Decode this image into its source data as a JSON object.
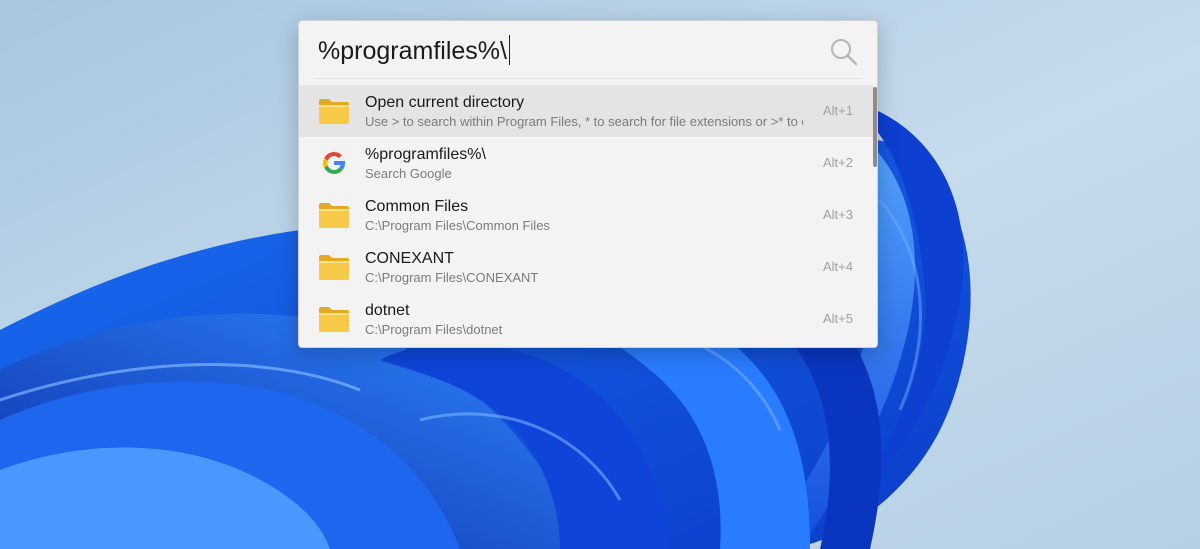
{
  "search": {
    "query": "%programfiles%\\"
  },
  "results": [
    {
      "icon": "folder-icon",
      "title": "Open current directory",
      "subtitle": "Use > to search within Program Files, * to search for file extensions or >* to combine both",
      "shortcut": "Alt+1"
    },
    {
      "icon": "google-icon",
      "title": "%programfiles%\\",
      "subtitle": "Search Google",
      "shortcut": "Alt+2"
    },
    {
      "icon": "folder-icon",
      "title": "Common Files",
      "subtitle": "C:\\Program Files\\Common Files",
      "shortcut": "Alt+3"
    },
    {
      "icon": "folder-icon",
      "title": "CONEXANT",
      "subtitle": "C:\\Program Files\\CONEXANT",
      "shortcut": "Alt+4"
    },
    {
      "icon": "folder-icon",
      "title": "dotnet",
      "subtitle": "C:\\Program Files\\dotnet",
      "shortcut": "Alt+5"
    }
  ],
  "colors": {
    "selected_row": "#e4e4e4",
    "folder": "#f5c542",
    "panel": "#f3f3f3"
  }
}
